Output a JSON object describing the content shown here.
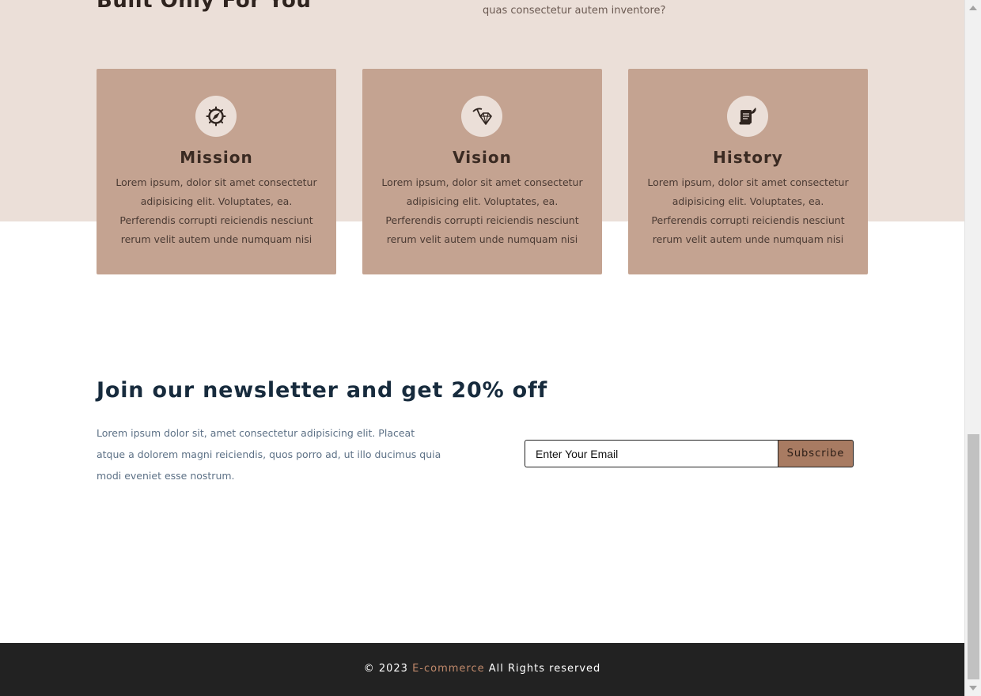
{
  "about": {
    "title": "Built Only For You",
    "description": "quas consectetur autem inventore?",
    "cards": [
      {
        "icon": "compass-icon",
        "title": "Mission",
        "text": "Lorem ipsum, dolor sit amet consectetur adipisicing elit. Voluptates, ea. Perferendis corrupti reiciendis nesciunt rerum velit autem unde numquam nisi"
      },
      {
        "icon": "diamond-pickaxe-icon",
        "title": "Vision",
        "text": "Lorem ipsum, dolor sit amet consectetur adipisicing elit. Voluptates, ea. Perferendis corrupti reiciendis nesciunt rerum velit autem unde numquam nisi"
      },
      {
        "icon": "scroll-quill-icon",
        "title": "History",
        "text": "Lorem ipsum, dolor sit amet consectetur adipisicing elit. Voluptates, ea. Perferendis corrupti reiciendis nesciunt rerum velit autem unde numquam nisi"
      }
    ]
  },
  "newsletter": {
    "title": "Join our newsletter and get 20% off",
    "text": "Lorem ipsum dolor sit, amet consectetur adipisicing elit. Placeat atque a dolorem magni reiciendis, quos porro ad, ut illo ducimus quia modi eveniet esse nostrum.",
    "email_placeholder": "Enter Your Email",
    "subscribe_label": "Subscribe"
  },
  "footer": {
    "prefix": "© 2023",
    "brand": "E-commerce",
    "suffix": "All Rights reserved"
  },
  "colors": {
    "accent": "#a87b62",
    "card_bg": "#c4a391",
    "section_bg": "#ebdfd8",
    "footer_bg": "#222222",
    "heading": "#172b3d"
  }
}
